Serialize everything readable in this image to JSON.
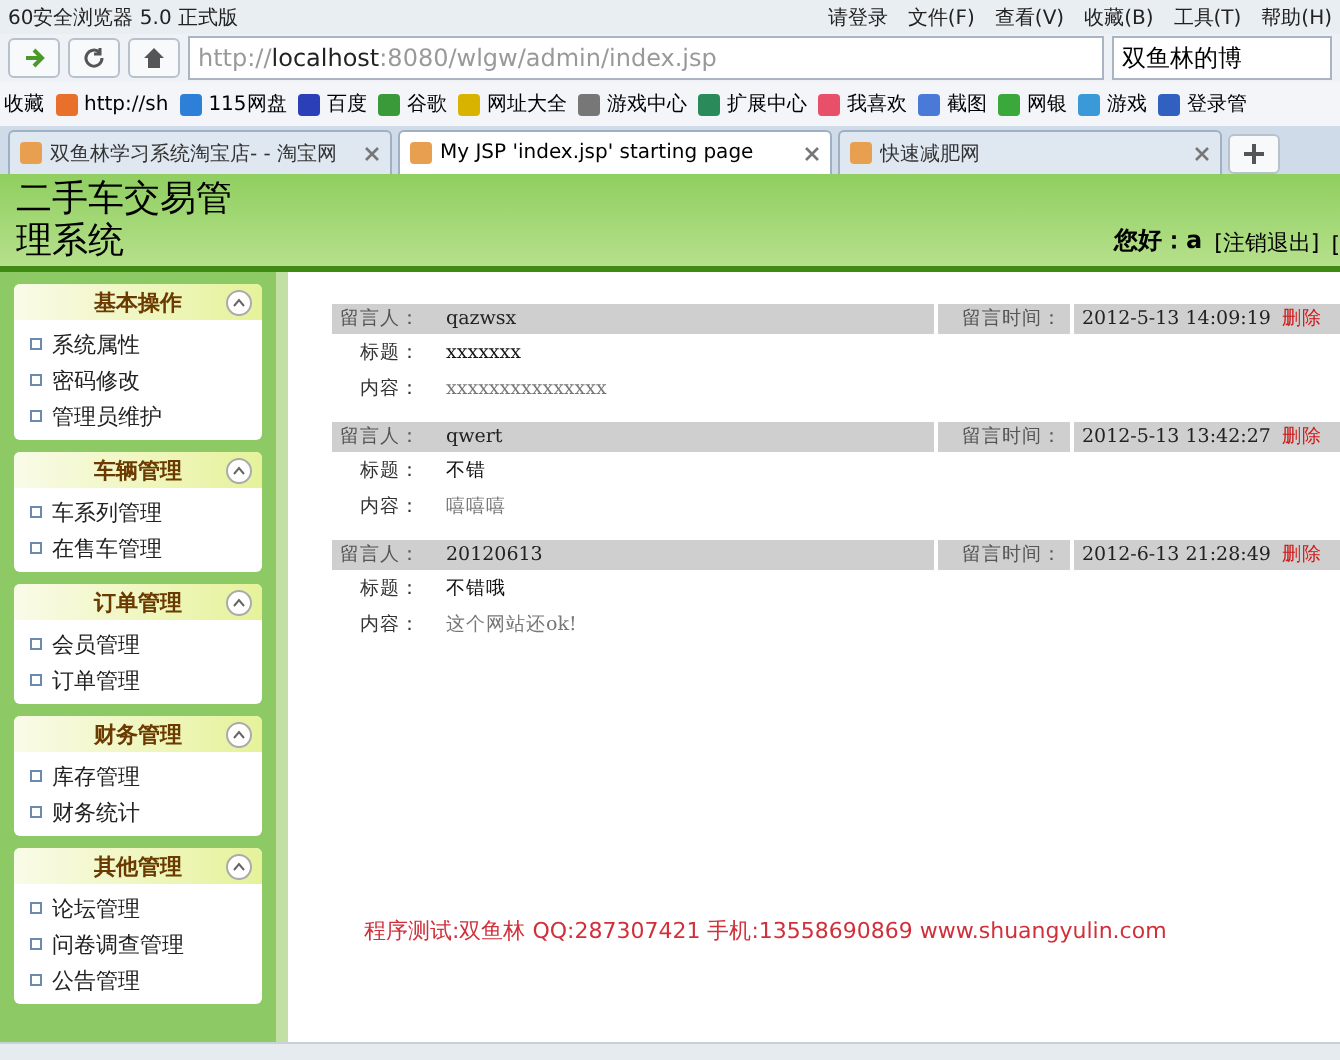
{
  "browser": {
    "title": "60安全浏览器 5.0 正式版",
    "account": "请登录",
    "menu": [
      "文件(F)",
      "查看(V)",
      "收藏(B)",
      "工具(T)",
      "帮助(H)"
    ],
    "address": {
      "url_prefix": "http://",
      "url_host": "localhost",
      "url_rest": ":8080/wlgw/admin/index.jsp"
    },
    "search_box": "双鱼林的博",
    "bookmarks_label": "收藏",
    "bookmarks": [
      {
        "label": "http://sh",
        "color": "#e8702a"
      },
      {
        "label": "115网盘",
        "color": "#2e7fd8"
      },
      {
        "label": "百度",
        "color": "#2a3fb8"
      },
      {
        "label": "谷歌",
        "color": "#3a9a3a"
      },
      {
        "label": "网址大全",
        "color": "#d8b400"
      },
      {
        "label": "游戏中心",
        "color": "#777777"
      },
      {
        "label": "扩展中心",
        "color": "#2a8a5a"
      },
      {
        "label": "我喜欢",
        "color": "#e8506a"
      },
      {
        "label": "截图",
        "color": "#4a7ad8"
      },
      {
        "label": "网银",
        "color": "#3aa83a"
      },
      {
        "label": "游戏",
        "color": "#3a9ad8"
      },
      {
        "label": "登录管",
        "color": "#3060c0"
      }
    ],
    "tabs": [
      {
        "label": "双鱼林学习系统淘宝店- - 淘宝网",
        "selected": false
      },
      {
        "label": "My JSP 'index.jsp' starting page",
        "selected": true
      },
      {
        "label": "快速减肥网",
        "selected": false
      }
    ]
  },
  "page": {
    "title": "二手车交易管理系统",
    "greeting": "您好：",
    "user": "a",
    "links": [
      "[注销退出]",
      "["
    ]
  },
  "sidebar": [
    {
      "title": "基本操作",
      "expanded": true,
      "items": [
        "系统属性",
        "密码修改",
        "管理员维护"
      ]
    },
    {
      "title": "车辆管理",
      "expanded": true,
      "items": [
        "车系列管理",
        "在售车管理"
      ]
    },
    {
      "title": "订单管理",
      "expanded": true,
      "items": [
        "会员管理",
        "订单管理"
      ]
    },
    {
      "title": "财务管理",
      "expanded": true,
      "items": [
        "库存管理",
        "财务统计"
      ]
    },
    {
      "title": "其他管理",
      "expanded": true,
      "items": [
        "论坛管理",
        "问卷调查管理",
        "公告管理"
      ]
    }
  ],
  "messages": [
    {
      "author_label": "留言人：",
      "author": "qazwsx",
      "time_label": "留言时间：",
      "time": "2012-5-13 14:09:19",
      "delete": "删除",
      "title_label": "标题：",
      "title": "xxxxxxx",
      "content_label": "内容：",
      "content": "xxxxxxxxxxxxxxx"
    },
    {
      "author_label": "留言人：",
      "author": "qwert",
      "time_label": "留言时间：",
      "time": "2012-5-13 13:42:27",
      "delete": "删除",
      "title_label": "标题：",
      "title": "不错",
      "content_label": "内容：",
      "content": "嘻嘻嘻"
    },
    {
      "author_label": "留言人：",
      "author": "20120613",
      "time_label": "留言时间：",
      "time": "2012-6-13 21:28:49",
      "delete": "删除",
      "title_label": "标题：",
      "title": "不错哦",
      "content_label": "内容：",
      "content": "这个网站还ok!"
    }
  ],
  "footer_note": "程序测试:双鱼林 QQ:287307421 手机:13558690869 www.shuangyulin.com"
}
